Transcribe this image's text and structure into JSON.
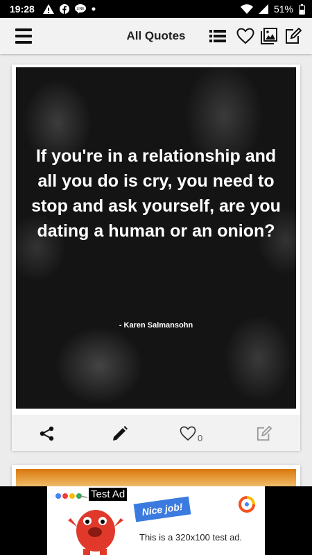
{
  "status_bar": {
    "time": "19:28",
    "battery": "51%"
  },
  "toolbar": {
    "title": "All Quotes"
  },
  "quote": {
    "text": "If you're in a relationship and all you do is cry, you need to stop and ask yourself, are you dating a human or an onion?",
    "author": "- Karen Salmansohn",
    "like_count": "0"
  },
  "ad": {
    "label": "Test Ad",
    "sign_text": "Nice job!",
    "text": "This is a 320x100 test ad."
  },
  "colors": {
    "toolbar_bg": "#f2f2f2",
    "card_bg": "#ffffff",
    "page_bg": "#ececec"
  }
}
